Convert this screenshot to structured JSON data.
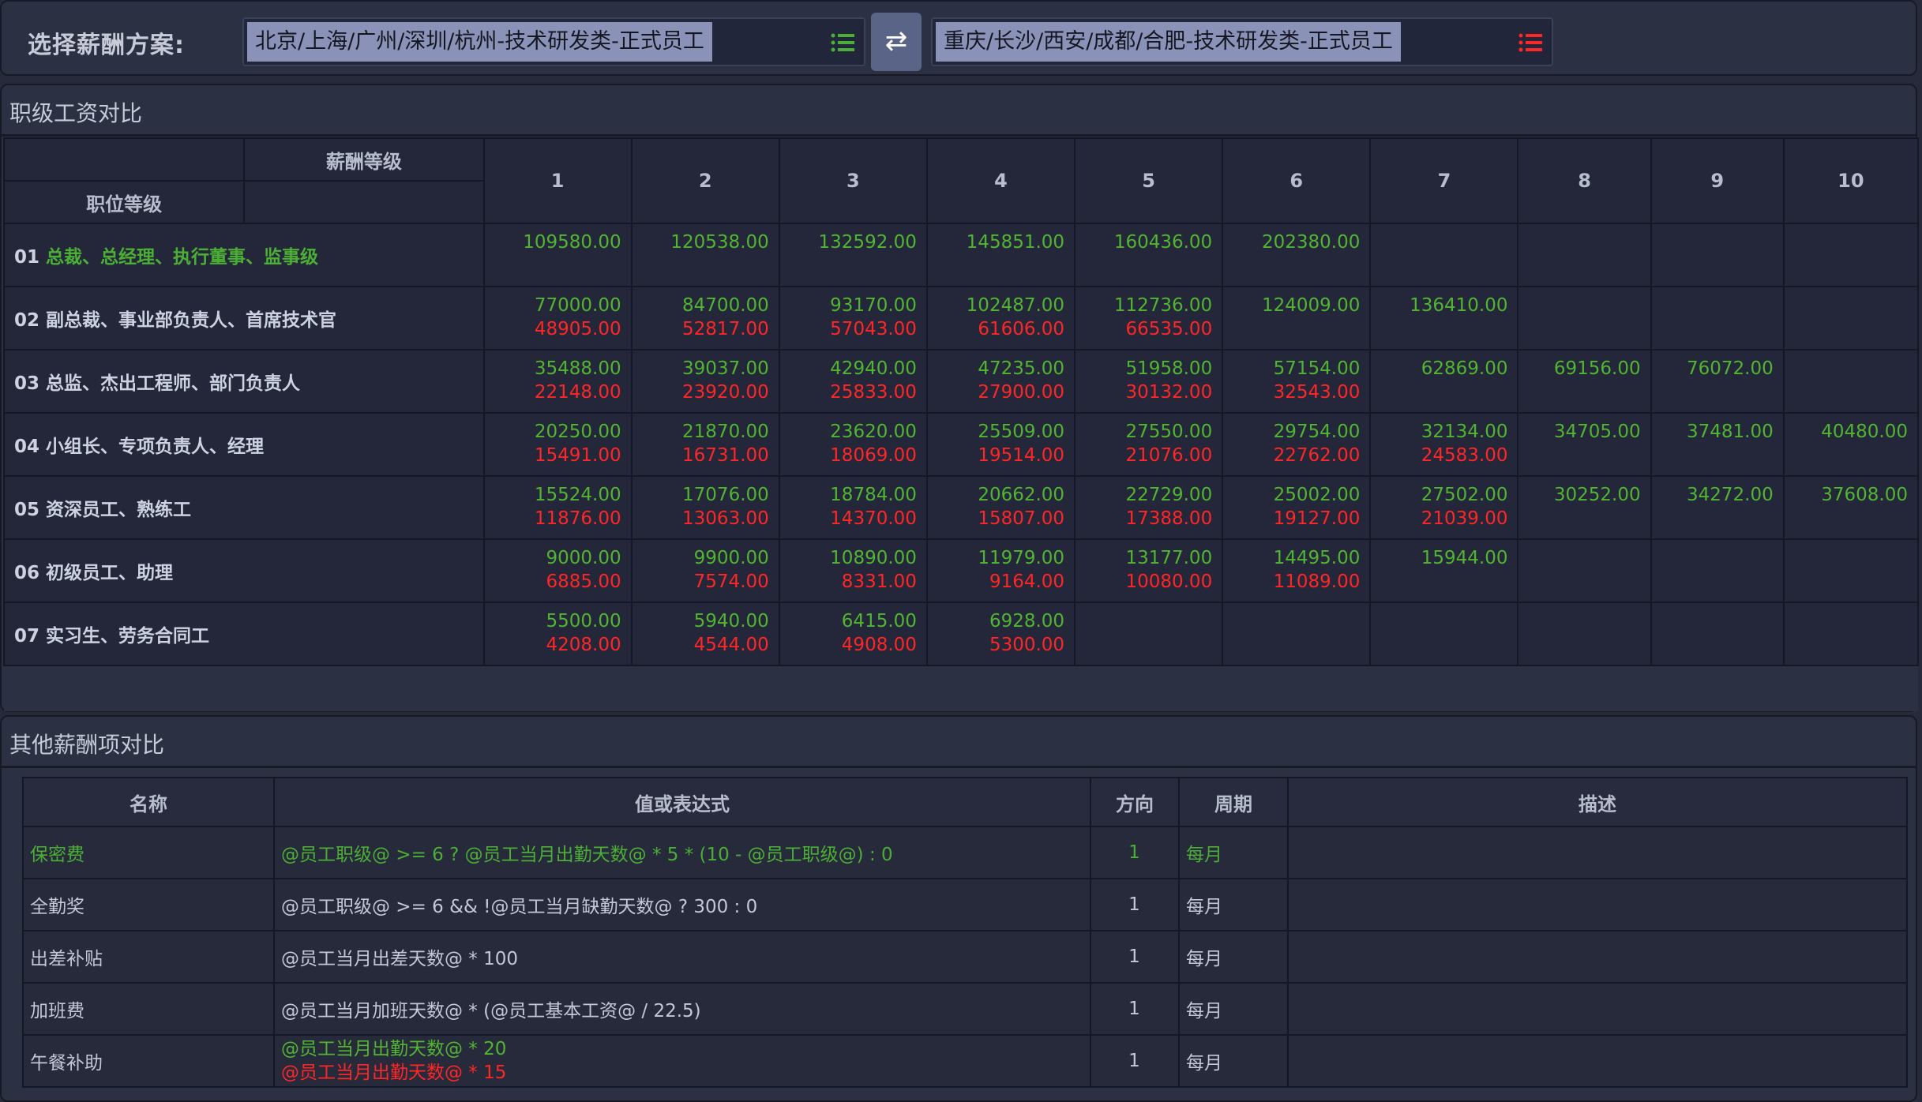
{
  "header": {
    "label": "选择薪酬方案:",
    "plan_left": "北京/上海/广州/深圳/杭州-技术研发类-正式员工",
    "plan_left_icon": "list-icon",
    "plan_left_icon_color": "#4caf35",
    "swap_icon": "⇄",
    "plan_right": "重庆/长沙/西安/成都/合肥-技术研发类-正式员工",
    "plan_right_icon": "list-icon",
    "plan_right_icon_color": "#ff2626"
  },
  "grade_panel": {
    "title": "职级工资对比",
    "corner_top": "薪酬等级",
    "corner_bottom": "职位等级",
    "levels": [
      "1",
      "2",
      "3",
      "4",
      "5",
      "6",
      "7",
      "8",
      "9",
      "10"
    ],
    "rows": [
      {
        "code": "01",
        "name": "总裁、总经理、执行董事、监事级",
        "highlight": true,
        "left": [
          "109580.00",
          "120538.00",
          "132592.00",
          "145851.00",
          "160436.00",
          "202380.00",
          "",
          "",
          "",
          ""
        ],
        "right": [
          "",
          "",
          "",
          "",
          "",
          "",
          "",
          "",
          "",
          ""
        ]
      },
      {
        "code": "02",
        "name": "副总裁、事业部负责人、首席技术官",
        "highlight": false,
        "left": [
          "77000.00",
          "84700.00",
          "93170.00",
          "102487.00",
          "112736.00",
          "124009.00",
          "136410.00",
          "",
          "",
          ""
        ],
        "right": [
          "48905.00",
          "52817.00",
          "57043.00",
          "61606.00",
          "66535.00",
          "",
          "",
          "",
          "",
          ""
        ]
      },
      {
        "code": "03",
        "name": "总监、杰出工程师、部门负责人",
        "highlight": false,
        "left": [
          "35488.00",
          "39037.00",
          "42940.00",
          "47235.00",
          "51958.00",
          "57154.00",
          "62869.00",
          "69156.00",
          "76072.00",
          ""
        ],
        "right": [
          "22148.00",
          "23920.00",
          "25833.00",
          "27900.00",
          "30132.00",
          "32543.00",
          "",
          "",
          "",
          ""
        ]
      },
      {
        "code": "04",
        "name": "小组长、专项负责人、经理",
        "highlight": false,
        "left": [
          "20250.00",
          "21870.00",
          "23620.00",
          "25509.00",
          "27550.00",
          "29754.00",
          "32134.00",
          "34705.00",
          "37481.00",
          "40480.00"
        ],
        "right": [
          "15491.00",
          "16731.00",
          "18069.00",
          "19514.00",
          "21076.00",
          "22762.00",
          "24583.00",
          "",
          "",
          ""
        ]
      },
      {
        "code": "05",
        "name": "资深员工、熟练工",
        "highlight": false,
        "left": [
          "15524.00",
          "17076.00",
          "18784.00",
          "20662.00",
          "22729.00",
          "25002.00",
          "27502.00",
          "30252.00",
          "34272.00",
          "37608.00"
        ],
        "right": [
          "11876.00",
          "13063.00",
          "14370.00",
          "15807.00",
          "17388.00",
          "19127.00",
          "21039.00",
          "",
          "",
          ""
        ]
      },
      {
        "code": "06",
        "name": "初级员工、助理",
        "highlight": false,
        "left": [
          "9000.00",
          "9900.00",
          "10890.00",
          "11979.00",
          "13177.00",
          "14495.00",
          "15944.00",
          "",
          "",
          ""
        ],
        "right": [
          "6885.00",
          "7574.00",
          "8331.00",
          "9164.00",
          "10080.00",
          "11089.00",
          "",
          "",
          "",
          ""
        ]
      },
      {
        "code": "07",
        "name": "实习生、劳务合同工",
        "highlight": false,
        "left": [
          "5500.00",
          "5940.00",
          "6415.00",
          "6928.00",
          "",
          "",
          "",
          "",
          "",
          ""
        ],
        "right": [
          "4208.00",
          "4544.00",
          "4908.00",
          "5300.00",
          "",
          "",
          "",
          "",
          "",
          ""
        ]
      }
    ]
  },
  "other_panel": {
    "title": "其他薪酬项对比",
    "headers": {
      "name": "名称",
      "expr": "值或表达式",
      "direction": "方向",
      "period": "周期",
      "desc": "描述"
    },
    "rows": [
      {
        "name": "保密费",
        "style": "green",
        "expr": "@员工职级@ >= 6 ? @员工当月出勤天数@ * 5 * (10 - @员工职级@) : 0",
        "expr2": "",
        "direction": "1",
        "period": "每月",
        "desc": ""
      },
      {
        "name": "全勤奖",
        "style": "normal",
        "expr": "@员工职级@ >= 6  && !@员工当月缺勤天数@ ? 300 : 0",
        "expr2": "",
        "direction": "1",
        "period": "每月",
        "desc": ""
      },
      {
        "name": "出差补贴",
        "style": "normal",
        "expr": "@员工当月出差天数@ * 100",
        "expr2": "",
        "direction": "1",
        "period": "每月",
        "desc": ""
      },
      {
        "name": "加班费",
        "style": "normal",
        "expr": "@员工当月加班天数@ * (@员工基本工资@ / 22.5)",
        "expr2": "",
        "direction": "1",
        "period": "每月",
        "desc": ""
      },
      {
        "name": "午餐补助",
        "style": "split",
        "expr": "@员工当月出勤天数@ * 20",
        "expr2": "@员工当月出勤天数@ * 15",
        "direction": "1",
        "period": "每月",
        "desc": ""
      }
    ]
  },
  "colors": {
    "left_plan": "#52b531",
    "right_plan": "#ff2626",
    "background": "#262a3b"
  }
}
